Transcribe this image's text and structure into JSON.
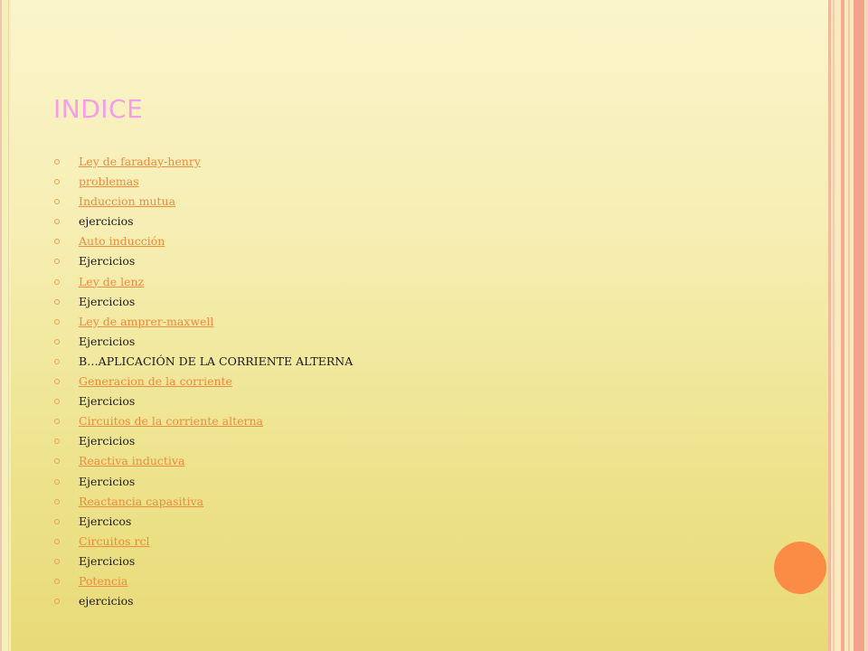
{
  "slide": {
    "title": "INDICE",
    "colors": {
      "title": "#f59ee7",
      "link": "#f08a3c",
      "text": "#1a1a1a",
      "accent_circle": "#fb8c46"
    },
    "items": [
      {
        "label": "Ley de faraday-henry",
        "link": true
      },
      {
        "label": " problemas",
        "link": true
      },
      {
        "label": "Induccion mutua",
        "link": true
      },
      {
        "label": "ejercicios",
        "link": false
      },
      {
        "label": "Auto inducción",
        "link": true
      },
      {
        "label": "Ejercicios",
        "link": false
      },
      {
        "label": "Ley de lenz",
        "link": true
      },
      {
        "label": "Ejercicios",
        "link": false
      },
      {
        "label": "Ley de amprer-maxwell",
        "link": true
      },
      {
        "label": "Ejercicios",
        "link": false
      },
      {
        "label": "B…APLICACIÓN DE LA CORRIENTE ALTERNA",
        "link": false
      },
      {
        "label": "Generacion de la corriente",
        "link": true
      },
      {
        "label": "Ejercicios",
        "link": false
      },
      {
        "label": "Circuitos de la corriente alterna",
        "link": true
      },
      {
        "label": "Ejercicios",
        "link": false
      },
      {
        "label": "Reactiva inductiva",
        "link": true
      },
      {
        "label": "Ejercicios",
        "link": false
      },
      {
        "label": "Reactancia capasitiva",
        "link": true
      },
      {
        "label": "Ejercicos",
        "link": false
      },
      {
        "label": "Circuitos rcl",
        "link": true
      },
      {
        "label": "Ejercicios",
        "link": false
      },
      {
        "label": "Potencia",
        "link": true
      },
      {
        "label": "ejercicios",
        "link": false
      }
    ]
  }
}
